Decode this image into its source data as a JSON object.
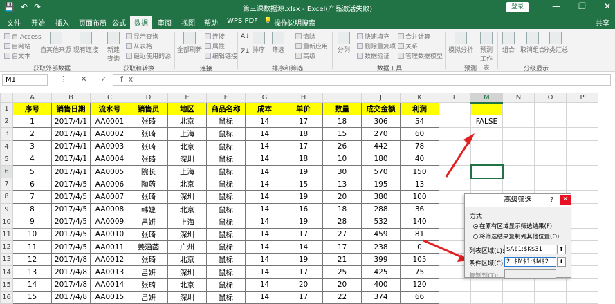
{
  "titlebar": {
    "qat_save": "💾",
    "qat_undo": "↶",
    "qat_redo": "↷",
    "title": "第三课数据源.xlsx - Excel(产品激活失败)",
    "login": "登录",
    "min": "—",
    "max": "❐",
    "close": "✕"
  },
  "tabs": {
    "file": "文件",
    "home": "开始",
    "insert": "插入",
    "layout": "页面布局",
    "formulas": "公式",
    "data": "数据",
    "review": "审阅",
    "view": "视图",
    "help": "帮助",
    "wpspdf": "WPS PDF",
    "tellme": "操作说明搜索",
    "share": "共享"
  },
  "ribbon": {
    "access": "自 Access",
    "web": "自网站",
    "text": "自文本",
    "other": "自其他来源",
    "existing": "现有连接",
    "newquery": "新建查询",
    "showquery": "显示查询",
    "fromtable": "从表格",
    "recent": "最近使用的源",
    "refresh": "全部刷新",
    "connections": "连接",
    "properties": "属性",
    "editlinks": "编辑链接",
    "sortaz": "A↓",
    "sortza": "Z↓",
    "sort": "排序",
    "filter": "筛选",
    "clear": "清除",
    "reapply": "重新应用",
    "advanced": "高级",
    "split": "分列",
    "flashfill": "快速填充",
    "removedup": "删除重复项",
    "validation": "数据验证",
    "consolidate": "合并计算",
    "relations": "关系",
    "datamodel": "管理数据模型",
    "whatif": "模拟分析",
    "forecast": "预测工作表",
    "group": "组合",
    "ungroup": "取消组合",
    "subtotal": "分类汇总",
    "g_external": "获取外部数据",
    "g_transform": "获取和转换",
    "g_conn": "连接",
    "g_sortfilter": "排序和筛选",
    "g_datatools": "数据工具",
    "g_forecast": "预测",
    "g_outline": "分级显示"
  },
  "formula_bar": {
    "namebox": "M1",
    "icons": "⋮ ✕ ✓ fx",
    "content": ""
  },
  "sheet": {
    "columns": [
      "A",
      "B",
      "C",
      "D",
      "E",
      "F",
      "G",
      "H",
      "I",
      "J",
      "K",
      "L",
      "M",
      "N",
      "O",
      "P"
    ],
    "headers": [
      "序号",
      "销售日期",
      "流水号",
      "销售员",
      "地区",
      "商品名称",
      "成本",
      "单价",
      "数量",
      "成交金额",
      "利润"
    ],
    "rows": [
      [
        "1",
        "2017/4/1",
        "AA0001",
        "张琦",
        "北京",
        "鼠标",
        "14",
        "17",
        "18",
        "306",
        "54"
      ],
      [
        "2",
        "2017/4/1",
        "AA0002",
        "张琦",
        "上海",
        "鼠标",
        "14",
        "18",
        "15",
        "270",
        "60"
      ],
      [
        "3",
        "2017/4/1",
        "AA0003",
        "张琦",
        "北京",
        "鼠标",
        "14",
        "17",
        "26",
        "442",
        "78"
      ],
      [
        "4",
        "2017/4/1",
        "AA0004",
        "张琦",
        "深圳",
        "鼠标",
        "14",
        "18",
        "10",
        "180",
        "40"
      ],
      [
        "5",
        "2017/4/1",
        "AA0005",
        "院长",
        "上海",
        "鼠标",
        "14",
        "19",
        "30",
        "570",
        "150"
      ],
      [
        "6",
        "2017/4/5",
        "AA0006",
        "陶药",
        "北京",
        "鼠标",
        "14",
        "15",
        "13",
        "195",
        "13"
      ],
      [
        "7",
        "2017/4/5",
        "AA0007",
        "张琦",
        "深圳",
        "鼠标",
        "14",
        "19",
        "20",
        "380",
        "100"
      ],
      [
        "8",
        "2017/4/5",
        "AA0008",
        "韩婕",
        "北京",
        "鼠标",
        "14",
        "16",
        "18",
        "288",
        "36"
      ],
      [
        "9",
        "2017/4/5",
        "AA0009",
        "吕妍",
        "上海",
        "鼠标",
        "14",
        "19",
        "28",
        "532",
        "140"
      ],
      [
        "10",
        "2017/4/5",
        "AA0010",
        "张琦",
        "深圳",
        "鼠标",
        "14",
        "17",
        "27",
        "459",
        "81"
      ],
      [
        "11",
        "2017/4/5",
        "AA0011",
        "姜涵菡",
        "广州",
        "鼠标",
        "14",
        "14",
        "17",
        "238",
        "0"
      ],
      [
        "12",
        "2017/4/8",
        "AA0012",
        "张琦",
        "北京",
        "鼠标",
        "14",
        "19",
        "21",
        "399",
        "105"
      ],
      [
        "13",
        "2017/4/8",
        "AA0013",
        "吕妍",
        "深圳",
        "鼠标",
        "14",
        "17",
        "25",
        "425",
        "75"
      ],
      [
        "14",
        "2017/4/8",
        "AA0014",
        "张琦",
        "北京",
        "鼠标",
        "14",
        "20",
        "20",
        "400",
        "120"
      ],
      [
        "15",
        "2017/4/8",
        "AA0015",
        "吕妍",
        "深圳",
        "鼠标",
        "14",
        "17",
        "22",
        "374",
        "66"
      ]
    ],
    "m2": "FALSE"
  },
  "dialog": {
    "title": "高级筛选",
    "help": "?",
    "close": "✕",
    "section": "方式",
    "opt1": "在原有区域显示筛选结果(F)",
    "opt2": "将筛选结果复制到其他位置(O)",
    "list_label": "列表区域(L):",
    "list_value": "$A$1:$K$31",
    "crit_label": "条件区域(C):",
    "crit_value": "2'!$M$1:$M$2",
    "copy_label": "复制到(T):",
    "pick": "⬆"
  },
  "colors": {
    "excel_green": "#217346",
    "header_yellow": "#ffff00",
    "arrow_red": "#e02020"
  }
}
